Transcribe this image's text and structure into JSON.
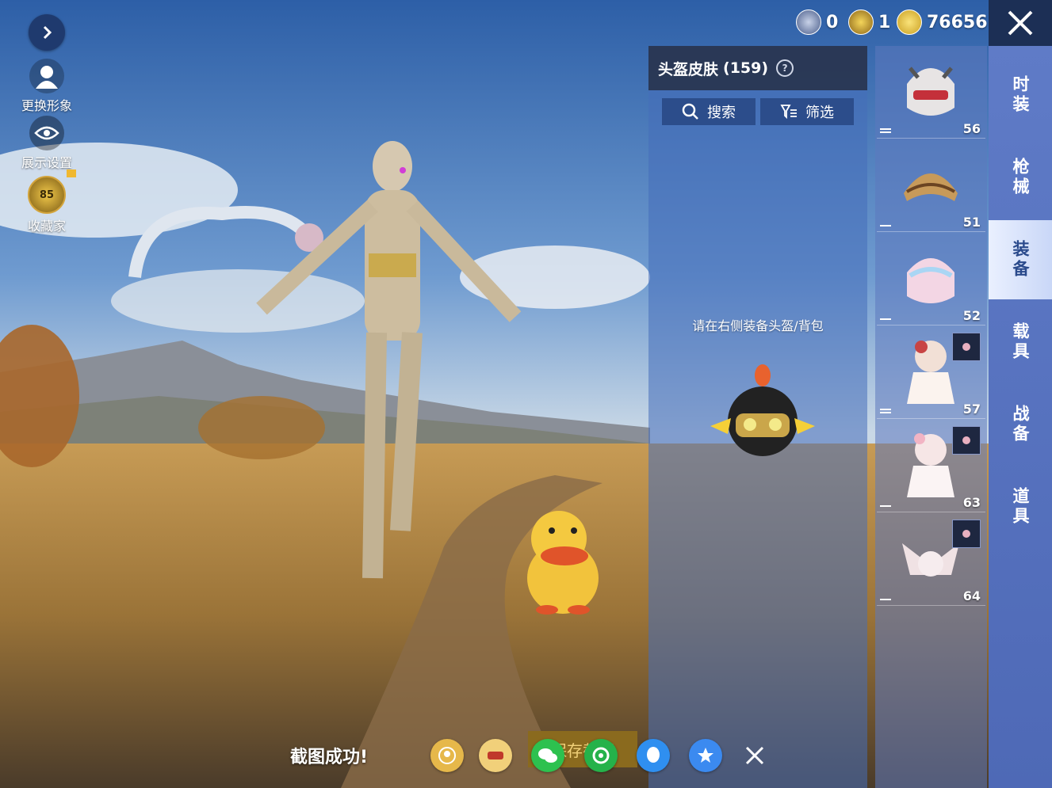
{
  "left_menu": {
    "expand_icon": "chevron-right-icon",
    "change_avatar_label": "更换形象",
    "display_settings_label": "展示设置",
    "collector_label": "收藏家",
    "collector_level": "85"
  },
  "currency": {
    "item1_value": "0",
    "item2_value": "1",
    "item3_value": "76656"
  },
  "panel": {
    "title": "头盔皮肤",
    "count": "(159)",
    "search_label": "搜索",
    "filter_label": "筛选",
    "hint": "请在右侧装备头盔/背包"
  },
  "items": [
    {
      "count": "56"
    },
    {
      "count": "51"
    },
    {
      "count": "52"
    },
    {
      "count": "57"
    },
    {
      "count": "63"
    },
    {
      "count": "64"
    }
  ],
  "tabs": [
    {
      "label": "时装"
    },
    {
      "label": "枪械"
    },
    {
      "label": "装备"
    },
    {
      "label": "载具"
    },
    {
      "label": "战备"
    },
    {
      "label": "道具"
    }
  ],
  "active_tab": "装备",
  "share": {
    "success_text": "截图成功!",
    "save_label": "保存截图"
  },
  "colors": {
    "accent_blue": "#4e69b6",
    "active_tab_text": "#2a4a8c"
  }
}
